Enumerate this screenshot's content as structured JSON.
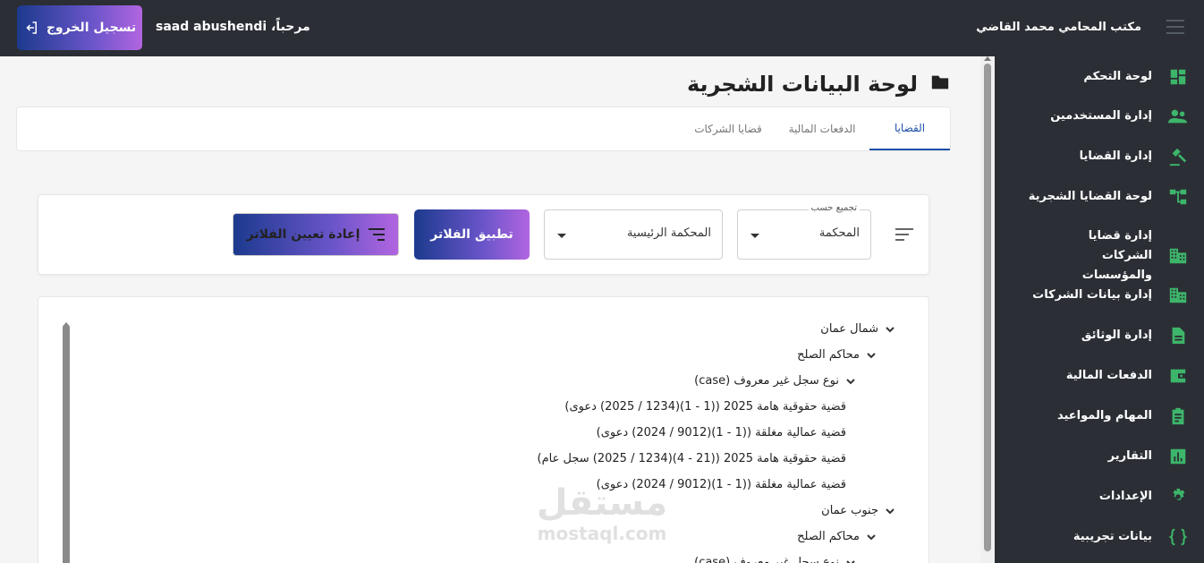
{
  "header": {
    "logout_label": "تسجيل الخروج",
    "welcome": "مرحباً، saad abushendi",
    "office_name": "مكتب المحامي محمد القاضي"
  },
  "sidebar": {
    "items": [
      {
        "label": "لوحة التحكم",
        "icon": "dashboard-icon"
      },
      {
        "label": "إدارة المستخدمين",
        "icon": "users-icon"
      },
      {
        "label": "إدارة القضايا",
        "icon": "gavel-icon"
      },
      {
        "label": "لوحة القضايا الشجرية",
        "icon": "tree-icon"
      },
      {
        "label": "إدارة قضايا الشركات والمؤسسات",
        "icon": "building-icon"
      },
      {
        "label": "إدارة بيانات الشركات",
        "icon": "building-icon"
      },
      {
        "label": "إدارة الوثائق",
        "icon": "document-icon"
      },
      {
        "label": "الدفعات المالية",
        "icon": "wallet-icon"
      },
      {
        "label": "المهام والمواعيد",
        "icon": "clipboard-icon"
      },
      {
        "label": "التقارير",
        "icon": "chart-icon"
      },
      {
        "label": "الإعدادات",
        "icon": "gear-icon"
      },
      {
        "label": "بيانات تجريبية",
        "icon": "braces-icon"
      }
    ],
    "accent_color": "#3db56a"
  },
  "page": {
    "title": "لوحة البيانات الشجرية",
    "tabs": [
      {
        "label": "القضايا",
        "active": true
      },
      {
        "label": "الدفعات المالية",
        "active": false
      },
      {
        "label": "قضايا الشركات",
        "active": false
      }
    ]
  },
  "filters": {
    "group_by_label": "تجميع حسب",
    "group_by_value": "المحكمة",
    "court_value": "المحكمة الرئيسية",
    "apply_label": "تطبيق الفلاتر",
    "reset_label": "إعادة تعيين الفلاتر"
  },
  "tree": {
    "rows": [
      {
        "label": "شمال عمان",
        "level": 0,
        "expandable": true
      },
      {
        "label": "محاكم الصلح",
        "level": 1,
        "expandable": true
      },
      {
        "label": "نوع سجل غير معروف (case)",
        "level": 2,
        "expandable": true
      },
      {
        "label": "قضية حقوقية هامة 2025 ((1 - 1)(1234 / 2025) دعوى)",
        "level": 3,
        "expandable": false
      },
      {
        "label": "قضية عمالية مغلقة ((1 - 1)(9012 / 2024) دعوى)",
        "level": 3,
        "expandable": false
      },
      {
        "label": "قضية حقوقية هامة 2025 ((21 - 4)(1234 / 2025) سجل عام)",
        "level": 3,
        "expandable": false
      },
      {
        "label": "قضية عمالية مغلقة ((1 - 1)(9012 / 2024) دعوى)",
        "level": 3,
        "expandable": false
      },
      {
        "label": "جنوب عمان",
        "level": 0,
        "expandable": true
      },
      {
        "label": "محاكم الصلح",
        "level": 1,
        "expandable": true
      },
      {
        "label": "نوع سجل غير معروف (case)",
        "level": 2,
        "expandable": true
      }
    ]
  },
  "watermark": {
    "arabic": "مستقل",
    "latin": "mostaql.com"
  }
}
